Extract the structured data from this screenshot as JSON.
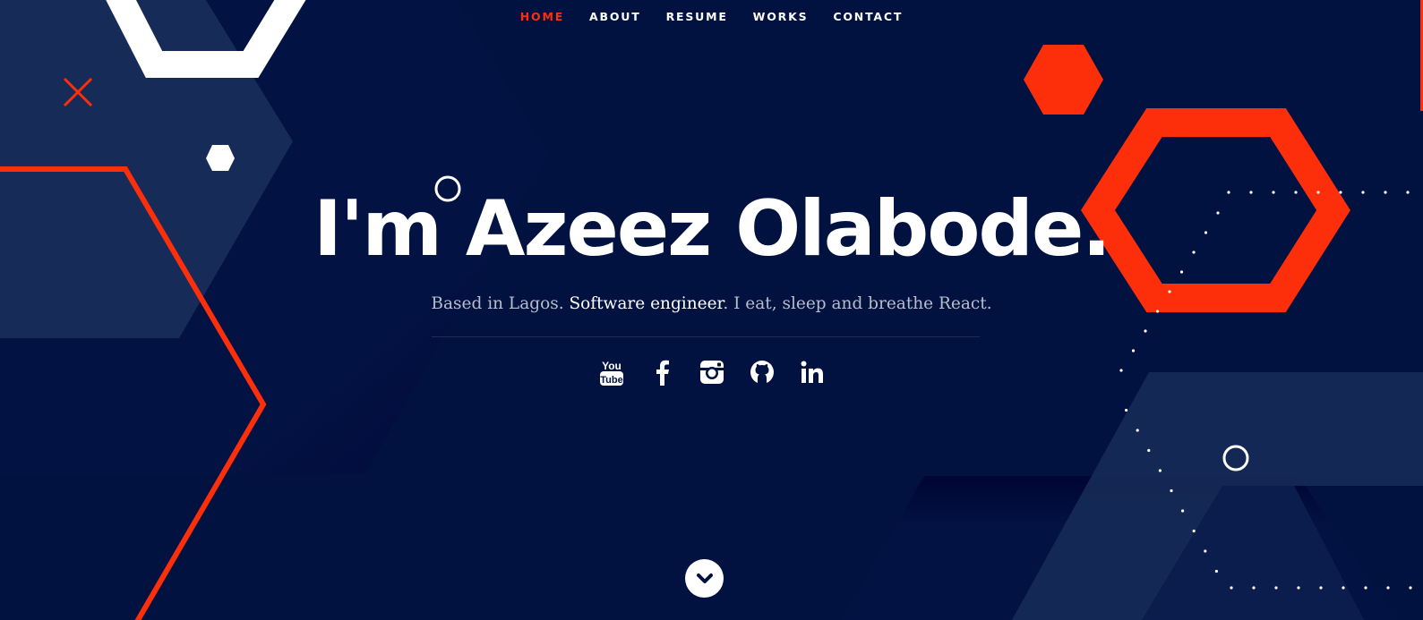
{
  "nav": {
    "items": [
      {
        "label": "HOME",
        "active": true
      },
      {
        "label": "ABOUT",
        "active": false
      },
      {
        "label": "RESUME",
        "active": false
      },
      {
        "label": "WORKS",
        "active": false
      },
      {
        "label": "CONTACT",
        "active": false
      }
    ]
  },
  "hero": {
    "title": "I'm Azeez Olabode.",
    "tagline_prefix": "Based in Lagos. ",
    "tagline_emphasis": "Software engineer",
    "tagline_suffix": ". I eat, sleep and breathe React."
  },
  "social": [
    {
      "icon": "youtube-icon"
    },
    {
      "icon": "facebook-icon"
    },
    {
      "icon": "instagram-icon"
    },
    {
      "icon": "github-icon"
    },
    {
      "icon": "linkedin-icon"
    }
  ],
  "scroll": {
    "icon": "chevron-down-icon"
  },
  "colors": {
    "background": "#011241",
    "panel": "#162b58",
    "accent": "#fd2e0a",
    "text": "#ffffff",
    "muted_text": "#b9bdcb"
  }
}
